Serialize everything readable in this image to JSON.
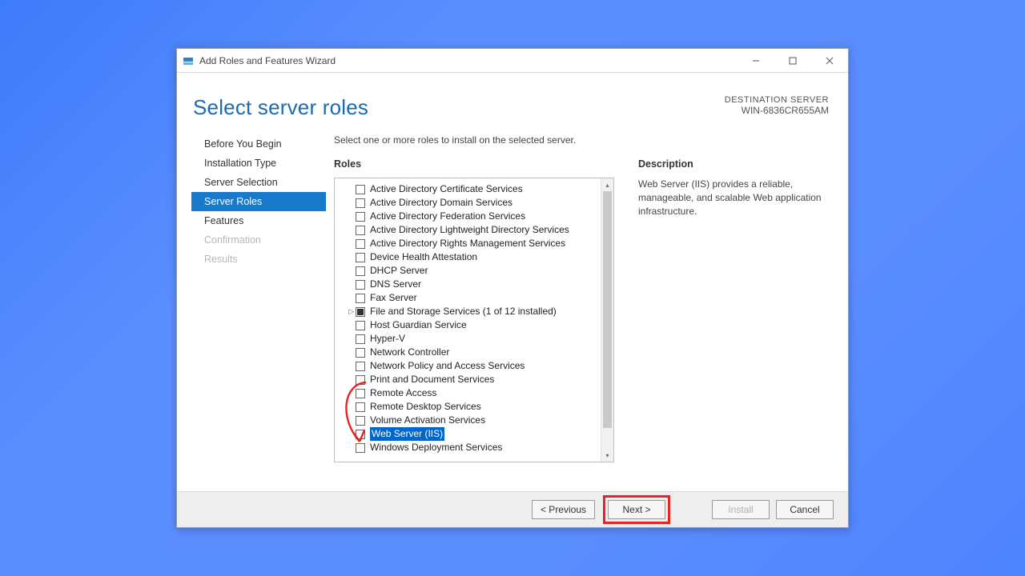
{
  "window": {
    "title": "Add Roles and Features Wizard"
  },
  "header": {
    "page_title": "Select server roles",
    "dest_label": "DESTINATION SERVER",
    "dest_name": "WIN-6836CR655AM"
  },
  "sidebar": {
    "items": [
      {
        "label": "Before You Begin",
        "state": "normal"
      },
      {
        "label": "Installation Type",
        "state": "normal"
      },
      {
        "label": "Server Selection",
        "state": "normal"
      },
      {
        "label": "Server Roles",
        "state": "active"
      },
      {
        "label": "Features",
        "state": "normal"
      },
      {
        "label": "Confirmation",
        "state": "disabled"
      },
      {
        "label": "Results",
        "state": "disabled"
      }
    ]
  },
  "main": {
    "instruction": "Select one or more roles to install on the selected server.",
    "roles_heading": "Roles",
    "desc_heading": "Description",
    "desc_text": "Web Server (IIS) provides a reliable, manageable, and scalable Web application infrastructure.",
    "roles": [
      {
        "label": "Active Directory Certificate Services"
      },
      {
        "label": "Active Directory Domain Services"
      },
      {
        "label": "Active Directory Federation Services"
      },
      {
        "label": "Active Directory Lightweight Directory Services"
      },
      {
        "label": "Active Directory Rights Management Services"
      },
      {
        "label": "Device Health Attestation"
      },
      {
        "label": "DHCP Server"
      },
      {
        "label": "DNS Server"
      },
      {
        "label": "Fax Server"
      },
      {
        "label": "File and Storage Services (1 of 12 installed)",
        "expander": true,
        "check": "partial"
      },
      {
        "label": "Host Guardian Service"
      },
      {
        "label": "Hyper-V"
      },
      {
        "label": "Network Controller"
      },
      {
        "label": "Network Policy and Access Services"
      },
      {
        "label": "Print and Document Services"
      },
      {
        "label": "Remote Access"
      },
      {
        "label": "Remote Desktop Services"
      },
      {
        "label": "Volume Activation Services"
      },
      {
        "label": "Web Server (IIS)",
        "selected": true
      },
      {
        "label": "Windows Deployment Services"
      }
    ]
  },
  "footer": {
    "prev": "< Previous",
    "next": "Next >",
    "install": "Install",
    "cancel": "Cancel"
  }
}
